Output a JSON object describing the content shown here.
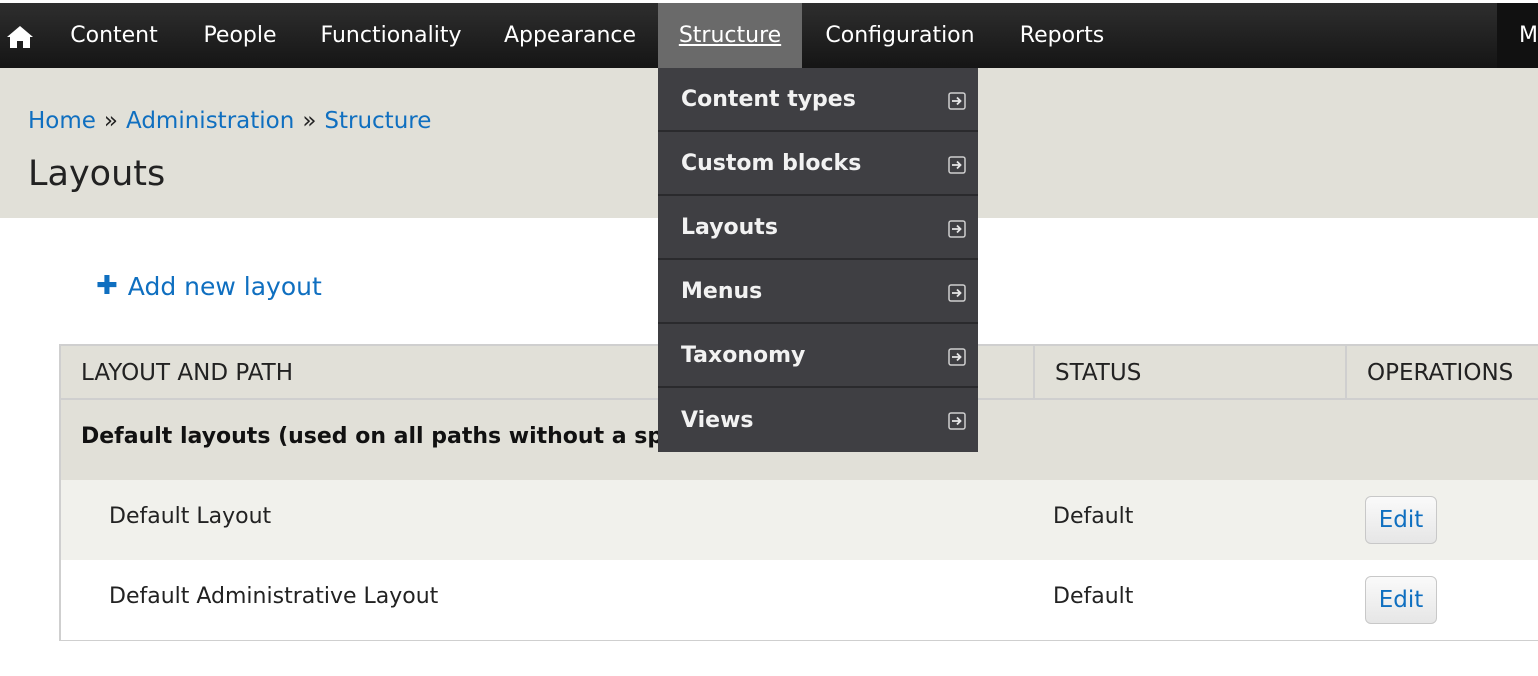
{
  "toolbar": {
    "items": [
      {
        "label": "Content"
      },
      {
        "label": "People"
      },
      {
        "label": "Functionality"
      },
      {
        "label": "Appearance"
      },
      {
        "label": "Structure"
      },
      {
        "label": "Configuration"
      },
      {
        "label": "Reports"
      }
    ],
    "active_item": "Structure",
    "overflow_label": "M"
  },
  "structure_menu": {
    "items": [
      {
        "label": "Content types"
      },
      {
        "label": "Custom blocks"
      },
      {
        "label": "Layouts"
      },
      {
        "label": "Menus"
      },
      {
        "label": "Taxonomy"
      },
      {
        "label": "Views"
      }
    ]
  },
  "breadcrumb": {
    "home": "Home",
    "separator": "»",
    "administration": "Administration",
    "structure": "Structure"
  },
  "page": {
    "title": "Layouts",
    "add_link": "Add new layout"
  },
  "table": {
    "headers": [
      "LAYOUT AND PATH",
      "STATUS",
      "OPERATIONS"
    ],
    "group_label": "Default layouts (used on all paths without a specific layout)",
    "rows": [
      {
        "name": "Default Layout",
        "status": "Default",
        "operation": "Edit"
      },
      {
        "name": "Default Administrative Layout",
        "status": "Default",
        "operation": "Edit"
      }
    ]
  },
  "colors": {
    "link": "#0f6fc0",
    "toolbar": "#1e1e1e",
    "toolbar_active": "#6a6a6a",
    "dropdown": "#3f3f43",
    "header_bg": "#e1e0d8"
  }
}
